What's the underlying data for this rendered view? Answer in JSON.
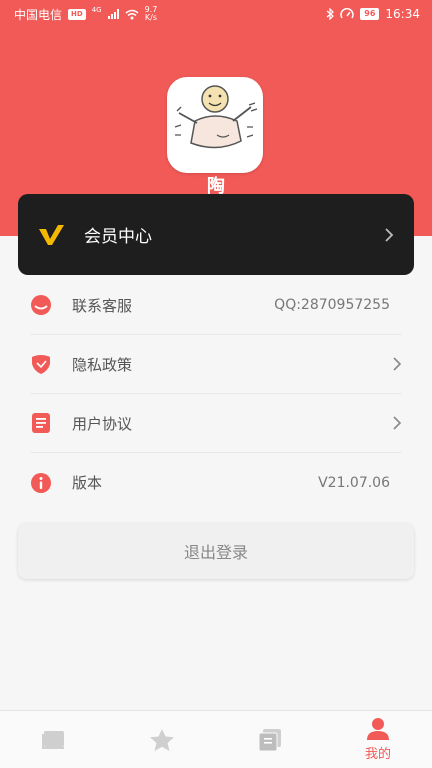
{
  "status_bar": {
    "carrier": "中国电信",
    "hd": "HD",
    "network": "4G",
    "speed_value": "9.7",
    "speed_unit": "K/s",
    "battery": "96",
    "time": "16:34"
  },
  "profile": {
    "username": "陶"
  },
  "vip": {
    "label": "会员中心"
  },
  "menu": {
    "items": [
      {
        "label": "联系客服",
        "value": "QQ:2870957255",
        "icon": "chat-bubble-icon"
      },
      {
        "label": "隐私政策",
        "value": "",
        "icon": "shield-icon"
      },
      {
        "label": "用户协议",
        "value": "",
        "icon": "document-icon"
      },
      {
        "label": "版本",
        "value": "V21.07.06",
        "icon": "info-icon"
      }
    ]
  },
  "logout": {
    "label": "退出登录"
  },
  "tabbar": {
    "tabs": [
      {
        "icon": "book-icon",
        "label": ""
      },
      {
        "icon": "star-icon",
        "label": ""
      },
      {
        "icon": "translate-icon",
        "label": ""
      },
      {
        "icon": "person-icon",
        "label": "我的"
      }
    ]
  },
  "colors": {
    "accent": "#f25a57",
    "vip_card": "#1e1e1e",
    "vip_logo": "#f5b800"
  }
}
